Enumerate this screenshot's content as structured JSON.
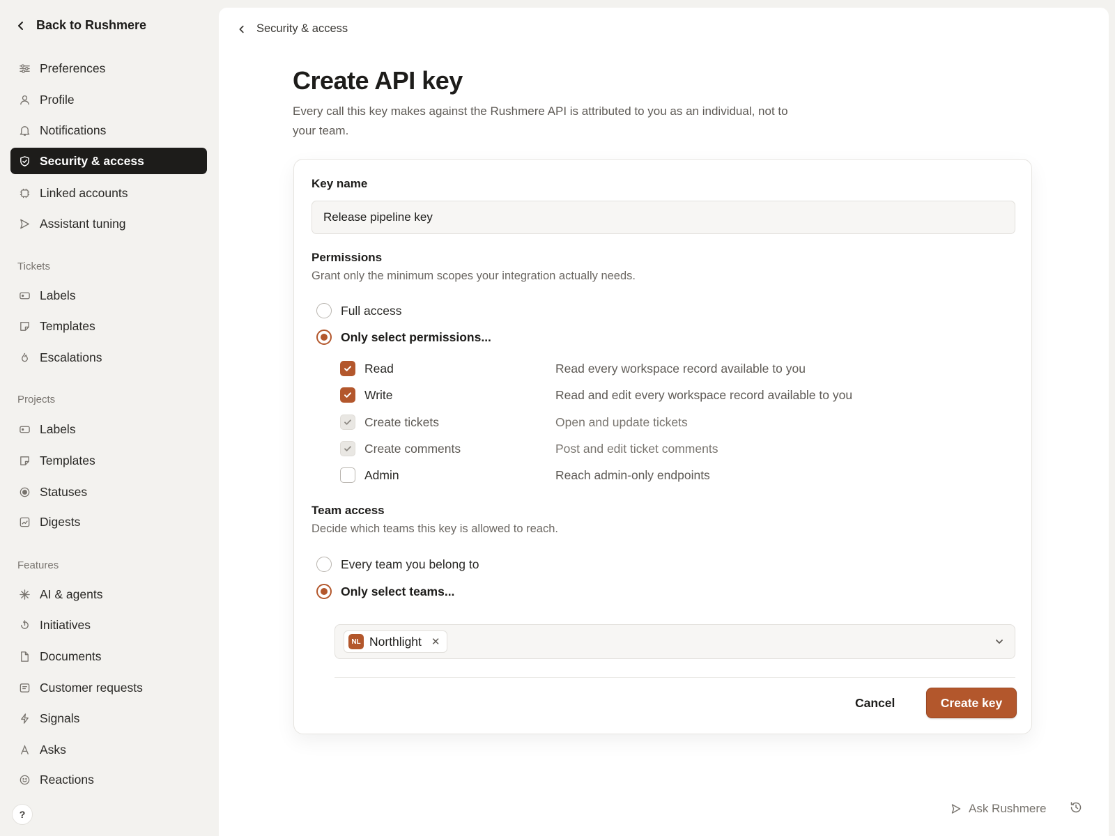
{
  "sidebar": {
    "back_label": "Back to Rushmere",
    "items": [
      {
        "label": "Preferences",
        "icon": "sliders-icon"
      },
      {
        "label": "Profile",
        "icon": "user-icon"
      },
      {
        "label": "Notifications",
        "icon": "bell-icon"
      },
      {
        "label": "Security & access",
        "icon": "shield-icon",
        "active": true
      },
      {
        "label": "Linked accounts",
        "icon": "chip-icon"
      },
      {
        "label": "Assistant tuning",
        "icon": "send-icon"
      }
    ],
    "sections": [
      {
        "label": "Tickets",
        "items": [
          {
            "label": "Labels",
            "icon": "label-icon"
          },
          {
            "label": "Templates",
            "icon": "template-icon"
          },
          {
            "label": "Escalations",
            "icon": "flame-icon"
          }
        ]
      },
      {
        "label": "Projects",
        "items": [
          {
            "label": "Labels",
            "icon": "label-icon"
          },
          {
            "label": "Templates",
            "icon": "template-icon"
          },
          {
            "label": "Statuses",
            "icon": "status-icon"
          },
          {
            "label": "Digests",
            "icon": "chart-icon"
          }
        ]
      },
      {
        "label": "Features",
        "items": [
          {
            "label": "AI & agents",
            "icon": "sparkle-icon"
          },
          {
            "label": "Initiatives",
            "icon": "initiative-icon"
          },
          {
            "label": "Documents",
            "icon": "document-icon"
          },
          {
            "label": "Customer requests",
            "icon": "message-icon"
          },
          {
            "label": "Signals",
            "icon": "bolt-icon"
          },
          {
            "label": "Asks",
            "icon": "text-icon"
          },
          {
            "label": "Reactions",
            "icon": "smile-icon"
          }
        ]
      }
    ],
    "help_label": "?"
  },
  "breadcrumb": {
    "label": "Security & access"
  },
  "page": {
    "title": "Create API key",
    "description": "Every call this key makes against the Rushmere API is attributed to you as an individual, not to your team."
  },
  "form": {
    "key_name": {
      "label": "Key name",
      "value": "Release pipeline key"
    },
    "permissions": {
      "label": "Permissions",
      "help": "Grant only the minimum scopes your integration actually needs.",
      "options": [
        {
          "label": "Full access",
          "selected": false
        },
        {
          "label": "Only select permissions...",
          "selected": true
        }
      ],
      "scopes": [
        {
          "name": "Read",
          "desc": "Read every workspace record available to you",
          "state": "checked"
        },
        {
          "name": "Write",
          "desc": "Read and edit every workspace record available to you",
          "state": "checked"
        },
        {
          "name": "Create tickets",
          "desc": "Open and update tickets",
          "state": "implied"
        },
        {
          "name": "Create comments",
          "desc": "Post and edit ticket comments",
          "state": "implied"
        },
        {
          "name": "Admin",
          "desc": "Reach admin-only endpoints",
          "state": "unchecked"
        }
      ]
    },
    "team_access": {
      "label": "Team access",
      "help": "Decide which teams this key is allowed to reach.",
      "options": [
        {
          "label": "Every team you belong to",
          "selected": false
        },
        {
          "label": "Only select teams...",
          "selected": true
        }
      ],
      "selected_teams": [
        {
          "initials": "NL",
          "name": "Northlight"
        }
      ]
    },
    "cancel_label": "Cancel",
    "submit_label": "Create key"
  },
  "footer": {
    "ask_label": "Ask Rushmere"
  },
  "colors": {
    "accent": "#b3572c",
    "active_nav": "#1d1c1a",
    "background": "#f3f2ef"
  }
}
